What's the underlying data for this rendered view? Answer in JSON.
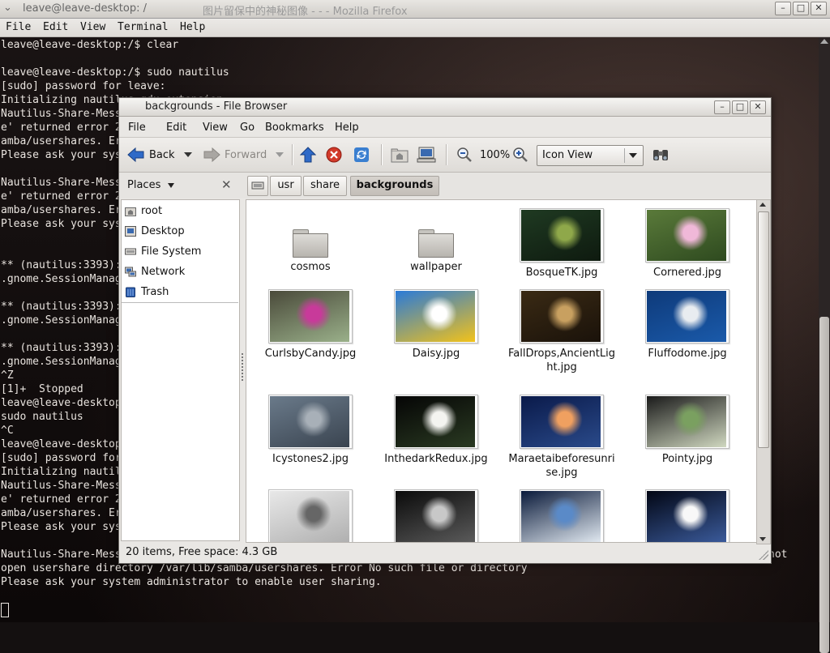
{
  "terminal": {
    "title": "leave@leave-desktop: /",
    "title_behind": "图片留保中的神秘图像 - - - Mozilla Firefox",
    "menu": [
      "File",
      "Edit",
      "View",
      "Terminal",
      "Help"
    ],
    "lines": [
      "leave@leave-desktop:/$ clear",
      "",
      "leave@leave-desktop:/$ sudo nautilus",
      "[sudo] password for leave:",
      "Initializing nautilus-gdu extension",
      "Nautilus-Share-Message: Called \"net usershare info\" but it failed: 'net usershar",
      "e' returned error 255: net usershare: cannot open usershare directory /var/lib/s",
      "amba/usershares. Error No such file or directory",
      "Please ask your system administrator to enable user sharing.",
      "",
      "Nautilus-Share-Message: Called \"net usershare info\" but it failed: 'net usershar",
      "e' returned error 255: net usershare: cannot open usershare directory /var/lib/s",
      "amba/usershares. Error No such file or directory",
      "Please ask your system administrator to enable user sharing.",
      "",
      "",
      "** (nautilus:3393): WARNING **: Unable to add monitor for /root/.local/share/Trash",
      ".gnome.SessionManager",
      "",
      "** (nautilus:3393): WARNING **: Unable to add monitor for /root/.local/share/Trash",
      ".gnome.SessionManager",
      "",
      "** (nautilus:3393): WARNING **: Unable to add monitor for /root/.local/share/Trash",
      ".gnome.SessionManager",
      "^Z",
      "[1]+  Stopped                 sudo nautilus",
      "leave@leave-desktop:/$ sudo nautilus",
      "sudo nautilus",
      "^C",
      "leave@leave-desktop:/$ sudo nautilus",
      "[sudo] password for leave:",
      "Initializing nautilus-gdu extension",
      "Nautilus-Share-Message: Called \"net usershare info\" but it failed: 'net usershar",
      "e' returned error 255: net usershare: cannot open usershare directory /var/lib/s",
      "amba/usershares. Error No such file or directory",
      "Please ask your system administrator to enable user sharing.",
      "",
      "Nautilus-Share-Message: Called \"net usershare info\" but it failed: 'net usershare' returned error 255: net usershare: cannot",
      "open usershare directory /var/lib/samba/usershares. Error No such file or directory",
      "Please ask your system administrator to enable user sharing."
    ]
  },
  "filebrowser": {
    "title": "backgrounds - File Browser",
    "menu": [
      "File",
      "Edit",
      "View",
      "Go",
      "Bookmarks",
      "Help"
    ],
    "toolbar": {
      "back": "Back",
      "forward": "Forward",
      "zoom": "100%",
      "view_mode": "Icon View"
    },
    "places_label": "Places",
    "breadcrumbs": [
      "usr",
      "share",
      "backgrounds"
    ],
    "sidebar": [
      "root",
      "Desktop",
      "File System",
      "Network",
      "Trash"
    ],
    "items": [
      {
        "name": "cosmos",
        "kind": "folder"
      },
      {
        "name": "wallpaper",
        "kind": "folder"
      },
      {
        "name": "BosqueTK.jpg",
        "kind": "image",
        "colors": [
          "#1f3a22",
          "#8fa84a",
          "#0e1a0f"
        ]
      },
      {
        "name": "Cornered.jpg",
        "kind": "image",
        "colors": [
          "#5a7a3a",
          "#f0b8d8",
          "#2e4a1f"
        ]
      },
      {
        "name": "CurlsbyCandy.jpg",
        "kind": "image",
        "colors": [
          "#4a4a3a",
          "#c83a9a",
          "#9ab08a"
        ]
      },
      {
        "name": "Daisy.jpg",
        "kind": "image",
        "colors": [
          "#2a7ad8",
          "#ffffff",
          "#f2c21a"
        ]
      },
      {
        "name": "FallDrops,AncientLight.jpg",
        "kind": "image",
        "colors": [
          "#3a2a14",
          "#c8a060",
          "#1a120a"
        ]
      },
      {
        "name": "Fluffodome.jpg",
        "kind": "image",
        "colors": [
          "#0e3a7a",
          "#e8ecf0",
          "#1a5aaa"
        ]
      },
      {
        "name": "Icystones2.jpg",
        "kind": "image",
        "colors": [
          "#6a7a8a",
          "#a8b0b8",
          "#3a4450"
        ]
      },
      {
        "name": "InthedarkRedux.jpg",
        "kind": "image",
        "colors": [
          "#050505",
          "#f4f4f0",
          "#2a3a22"
        ]
      },
      {
        "name": "Maraetaibeforesunrise.jpg",
        "kind": "image",
        "colors": [
          "#0a1a4a",
          "#f0a060",
          "#2a4a8a"
        ]
      },
      {
        "name": "Pointy.jpg",
        "kind": "image",
        "colors": [
          "#1a1a1a",
          "#7aa060",
          "#d0d8c0"
        ]
      },
      {
        "name": "",
        "kind": "image",
        "colors": [
          "#e8e8e8",
          "#666666",
          "#b0b0b0"
        ]
      },
      {
        "name": "",
        "kind": "image",
        "colors": [
          "#0a0a0a",
          "#c8c8c8",
          "#5a5a5a"
        ]
      },
      {
        "name": "",
        "kind": "image",
        "colors": [
          "#0a1a3a",
          "#5a8ac8",
          "#e0e8f0"
        ]
      },
      {
        "name": "",
        "kind": "image",
        "colors": [
          "#020614",
          "#f8f8f8",
          "#3a5a9a"
        ]
      }
    ],
    "status": "20 items, Free space: 4.3 GB"
  }
}
